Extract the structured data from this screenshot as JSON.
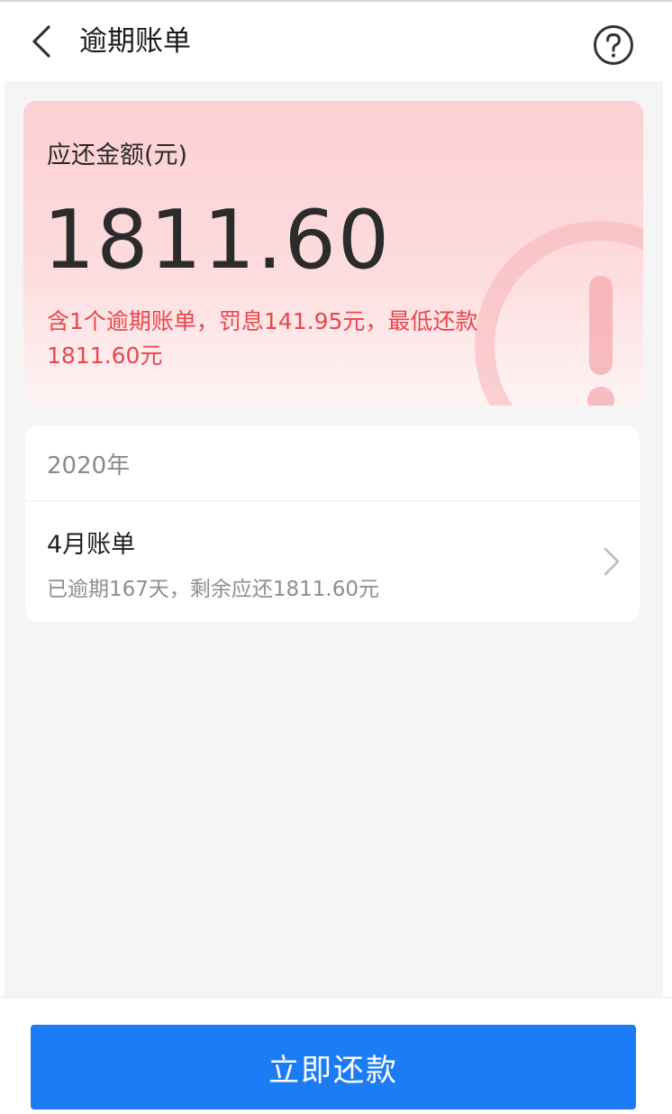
{
  "header": {
    "title": "逾期账单",
    "back_icon": "chevron-left-icon",
    "help_icon": "question-circle-icon"
  },
  "summary": {
    "label": "应还金额(元)",
    "amount": "1811.60",
    "note": "含1个逾期账单，罚息141.95元，最低还款1811.60元",
    "decor_icon": "exclamation-ring-icon"
  },
  "bills": {
    "year": "2020年",
    "items": [
      {
        "title": "4月账单",
        "detail": "已逾期167天，剩余应还1811.60元"
      }
    ]
  },
  "footer": {
    "pay_label": "立即还款"
  },
  "colors": {
    "accent": "#1c7cf6",
    "warning_text": "#e8474b",
    "card_gradient_top": "#fdcfd2"
  }
}
